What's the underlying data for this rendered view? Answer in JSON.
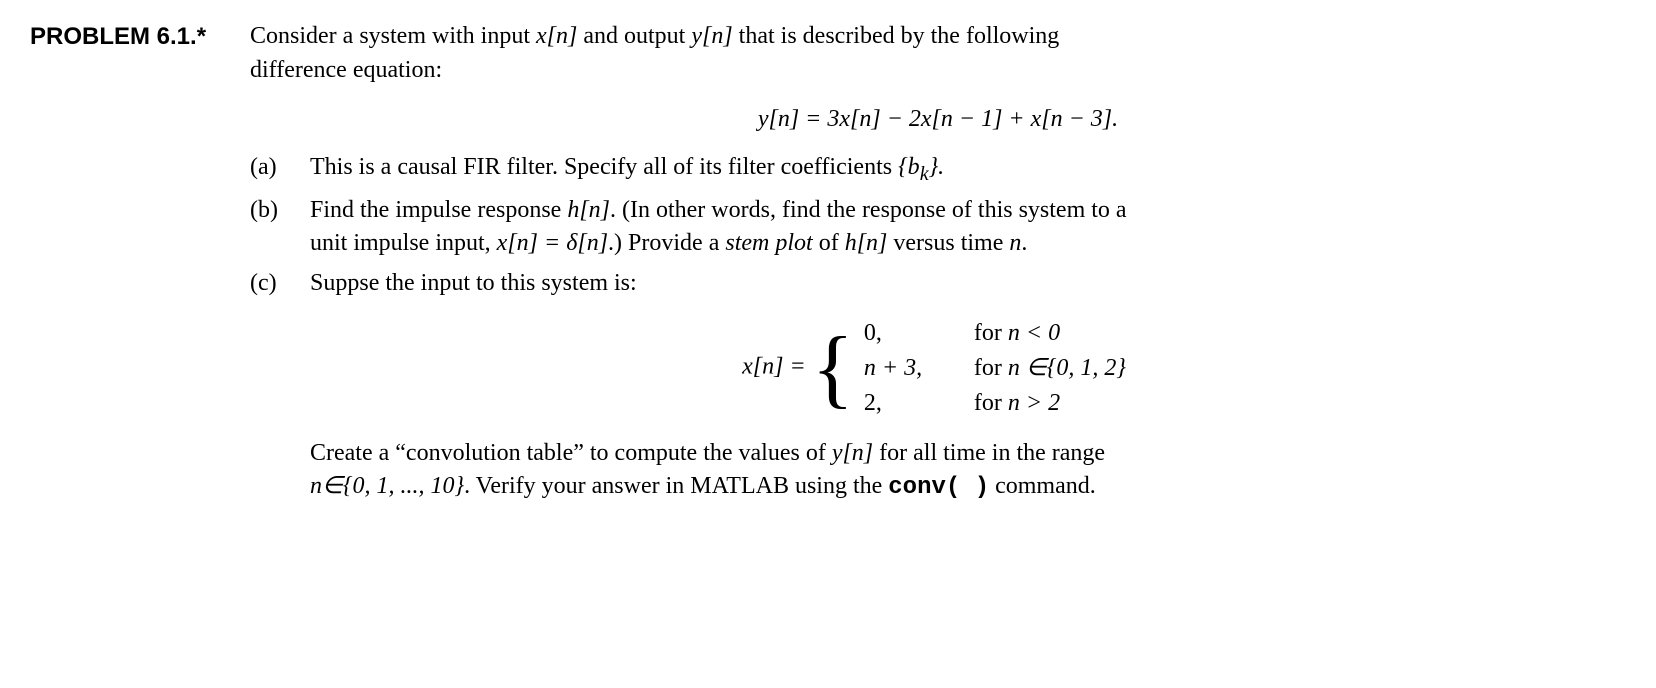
{
  "problem": {
    "label": "PROBLEM  6.1.*",
    "intro1": "Consider a system with input ",
    "intro_xn": "x[n]",
    "intro2": " and output ",
    "intro_yn": "y[n]",
    "intro3": " that is described by the following",
    "intro4": "difference equation:",
    "equation": "y[n] = 3x[n] − 2x[n − 1] + x[n − 3].",
    "parts": {
      "a": {
        "label": "(a)",
        "t1": "This is a causal FIR filter. Specify all of its filter coefficients ",
        "coef": "{b",
        "coef_sub": "k",
        "coef_end": "}."
      },
      "b": {
        "label": "(b)",
        "t1": "Find the impulse response ",
        "hn": "h[n]",
        "t2": ". (In other words, find the response of this system to a",
        "t3": "unit impulse input, ",
        "xn_eq": "x[n] = δ[n]",
        "t4": ".) Provide a ",
        "stem": "stem plot",
        "t5": " of ",
        "hn2": "h[n]",
        "t6": " versus time ",
        "nvar": "n",
        "t7": "."
      },
      "c": {
        "label": "(c)",
        "t1": "Suppse the input to this system is:",
        "lhs": "x[n] = ",
        "case1_v": "0,",
        "case1_c1": "for ",
        "case1_c2": "n < 0",
        "case2_v": "n + 3,",
        "case2_c1": "for ",
        "case2_c2": "n ∈{0, 1, 2}",
        "case3_v": "2,",
        "case3_c1": "for ",
        "case3_c2": "n > 2",
        "tail1a": "Create a “convolution table” to compute the values of ",
        "tail_yn": "y[n]",
        "tail1b": " for all time in the range",
        "tail2a": "n∈{0, 1, ..., 10}",
        "tail2b": ". Verify your answer in MATLAB using the ",
        "code": "conv(   )",
        "tail2c": " command."
      }
    }
  }
}
